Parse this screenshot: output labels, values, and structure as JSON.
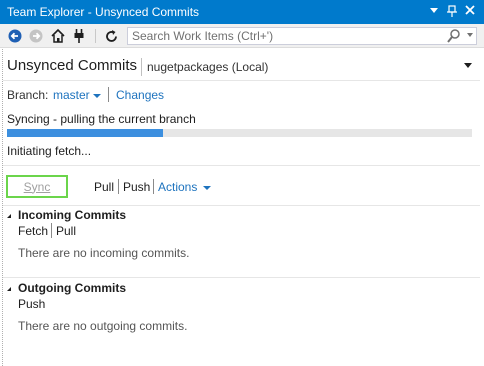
{
  "window": {
    "title": "Team Explorer - Unsynced Commits",
    "controls": {
      "dropdown": "▾",
      "pin": "📌",
      "close": "×"
    }
  },
  "toolbar": {
    "icons": [
      "back-arrow-icon",
      "forward-arrow-icon",
      "home-icon",
      "connect-plug-icon",
      "refresh-icon"
    ],
    "search": {
      "placeholder": "Search Work Items (Ctrl+')",
      "value": ""
    }
  },
  "page": {
    "title": "Unsynced Commits",
    "repository": "nugetpackages (Local)"
  },
  "branch_bar": {
    "label": "Branch:",
    "branch": "master",
    "changes_link": "Changes"
  },
  "sync_progress": {
    "status": "Syncing - pulling the current branch",
    "progress_fraction": 0.335,
    "detail": "Initiating fetch..."
  },
  "sync_actions": {
    "sync_button": "Sync",
    "pull": "Pull",
    "push": "Push",
    "actions": "Actions"
  },
  "incoming": {
    "title": "Incoming Commits",
    "fetch": "Fetch",
    "pull": "Pull",
    "empty": "There are no incoming commits."
  },
  "outgoing": {
    "title": "Outgoing Commits",
    "push": "Push",
    "empty": "There are no outgoing commits."
  },
  "colors": {
    "title_bar": "#007acc",
    "link": "#1e73be",
    "progress": "#3c8fdf",
    "sync_focus_border": "#6bd54b"
  }
}
